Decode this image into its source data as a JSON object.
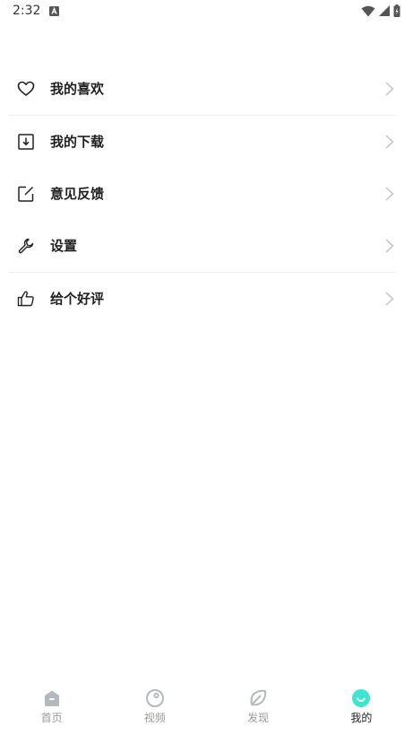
{
  "status": {
    "time": "2:32"
  },
  "menu": {
    "items": [
      {
        "label": "我的喜欢",
        "icon": "heart-icon"
      },
      {
        "label": "我的下载",
        "icon": "download-icon"
      },
      {
        "label": "意见反馈",
        "icon": "edit-icon"
      },
      {
        "label": "设置",
        "icon": "wrench-icon"
      },
      {
        "label": "给个好评",
        "icon": "thumbs-up-icon"
      }
    ]
  },
  "tabbar": {
    "tabs": [
      {
        "label": "首页",
        "icon": "home-icon",
        "active": false
      },
      {
        "label": "视频",
        "icon": "video-icon",
        "active": false
      },
      {
        "label": "发现",
        "icon": "discover-icon",
        "active": false
      },
      {
        "label": "我的",
        "icon": "profile-icon",
        "active": true
      }
    ],
    "active_color": "#3ee6d0",
    "inactive_color": "#b4b8bf"
  }
}
